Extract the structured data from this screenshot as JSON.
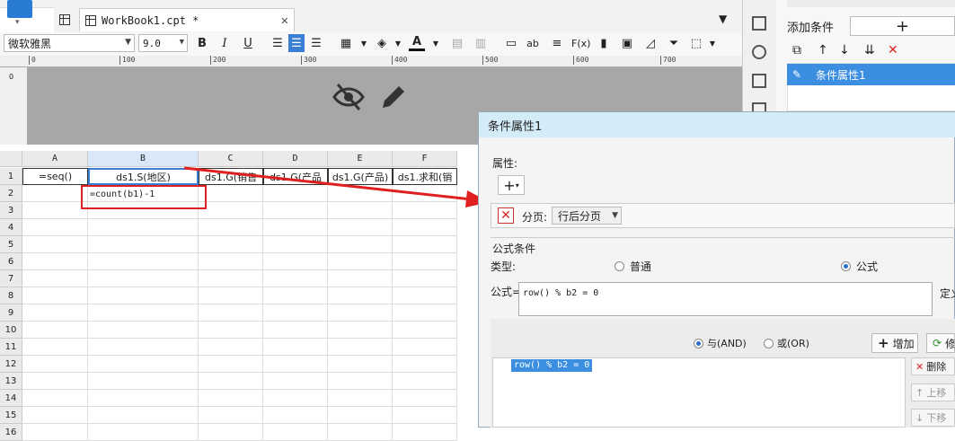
{
  "tab": {
    "title": "WorkBook1.cpt *"
  },
  "toolbar": {
    "font": "微软雅黑",
    "size": "9.0",
    "bold": "B",
    "italic": "I",
    "underline": "U",
    "ab": "ab",
    "fx": "F(x)"
  },
  "ruler": {
    "ticks": [
      "0",
      "100",
      "200",
      "300",
      "400",
      "500",
      "600",
      "700"
    ],
    "vtick": "0"
  },
  "sheet": {
    "columns": [
      "A",
      "B",
      "C",
      "D",
      "E",
      "F"
    ],
    "rows": [
      "1",
      "2",
      "3",
      "4",
      "5",
      "6",
      "7",
      "8",
      "9",
      "10",
      "11",
      "12",
      "13",
      "14",
      "15",
      "16"
    ],
    "row1": [
      "=seq()",
      "ds1.S(地区)",
      "ds1.G(销售",
      "ds1.G(产品",
      "ds1.G(产品)",
      "ds1.求和(销"
    ],
    "b2_formula": "=count(b1)-1"
  },
  "right_panel": {
    "add_condition": "添加条件",
    "add_symbol": "+",
    "condition_item": "条件属性1"
  },
  "dialog": {
    "title": "条件属性1",
    "attr_label": "属性:",
    "add_symbol": "+",
    "page_label": "分页:",
    "page_value": "行后分页",
    "formula_section": "公式条件",
    "type_label": "类型:",
    "type_normal": "普通",
    "type_formula": "公式",
    "formula_label": "公式=",
    "formula_value": "row() % b2 = 0",
    "define_label": "定义",
    "and_label": "与(AND)",
    "or_label": "或(OR)",
    "add_button": "增加",
    "modify_button": "修改",
    "list_item": "row() % b2 = 0",
    "delete_button": "删除",
    "up_button": "上移",
    "down_button": "下移"
  }
}
